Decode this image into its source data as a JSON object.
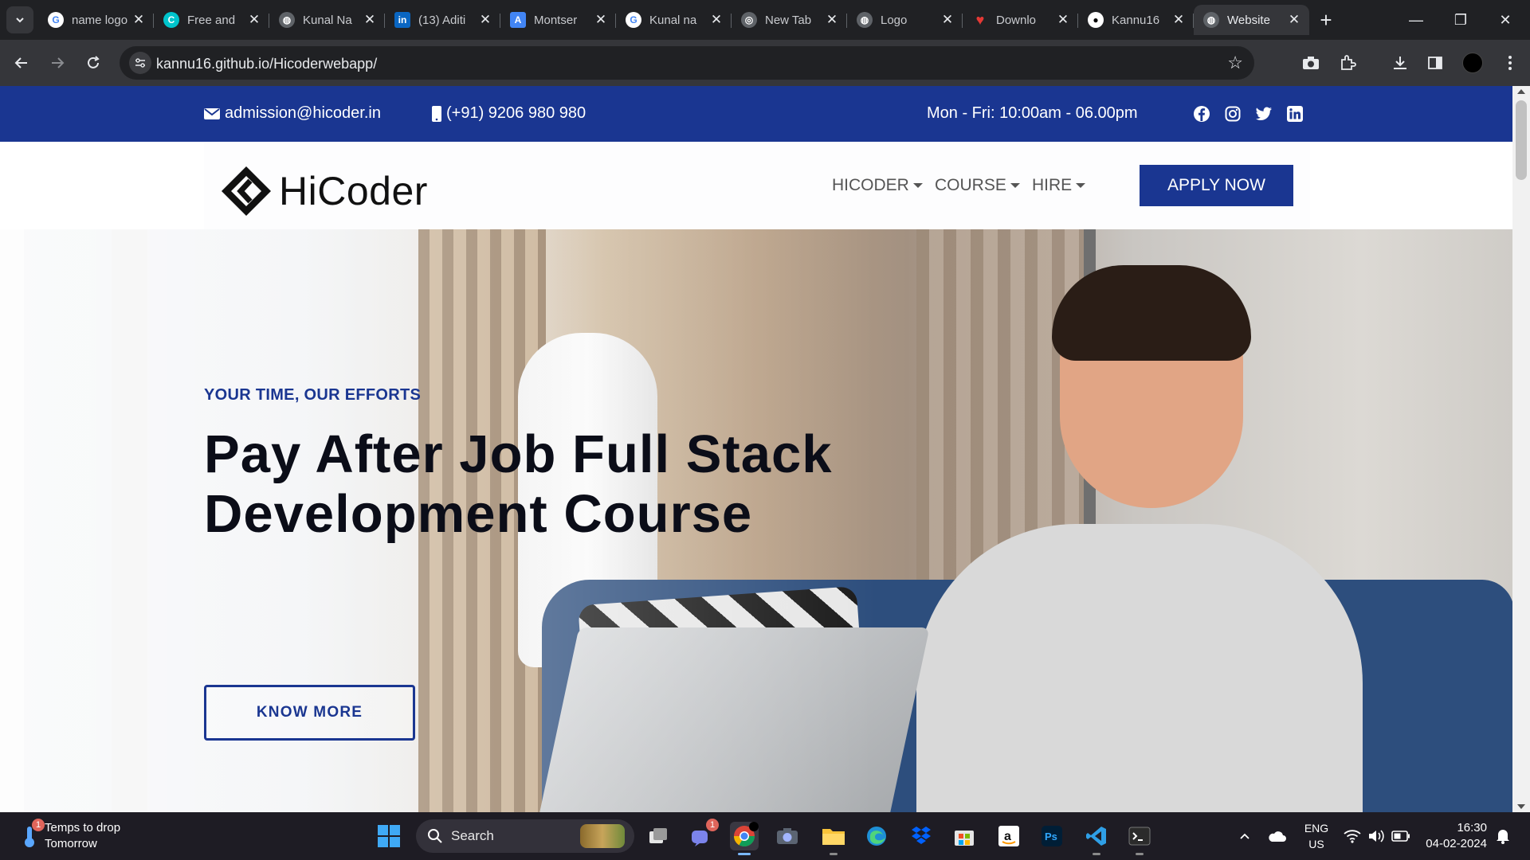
{
  "browser": {
    "tabs": [
      {
        "title": "name logo",
        "favicon": "google-icon",
        "color": "#ffffff"
      },
      {
        "title": "Free and",
        "favicon": "canva-icon",
        "color": "#00c4cc"
      },
      {
        "title": "Kunal Na",
        "favicon": "globe-icon",
        "color": "#9aa0a6"
      },
      {
        "title": "(13) Aditi",
        "favicon": "linkedin-icon",
        "color": "#0a66c2"
      },
      {
        "title": "Montser",
        "favicon": "google-fonts-icon",
        "color": "#4285f4"
      },
      {
        "title": "Kunal na",
        "favicon": "google-icon",
        "color": "#ffffff"
      },
      {
        "title": "New Tab",
        "favicon": "chrome-icon",
        "color": "#9aa0a6"
      },
      {
        "title": "Logo",
        "favicon": "globe-icon",
        "color": "#9aa0a6"
      },
      {
        "title": "Downlo",
        "favicon": "heart-icon",
        "color": "#e53935"
      },
      {
        "title": "Kannu16",
        "favicon": "github-icon",
        "color": "#ffffff"
      },
      {
        "title": "Website",
        "favicon": "globe-icon",
        "color": "#9aa0a6",
        "active": true
      }
    ],
    "url": "kannu16.github.io/Hicoderwebapp/"
  },
  "site": {
    "topbar": {
      "email": "admission@hicoder.in",
      "phone": "(+91) 9206 980 980",
      "hours": "Mon - Fri: 10:00am - 06.00pm"
    },
    "logo_text": "HiCoder",
    "menu": [
      {
        "label": "HICODER"
      },
      {
        "label": "COURSE"
      },
      {
        "label": "HIRE"
      }
    ],
    "apply_label": "APPLY NOW",
    "hero": {
      "tagline": "YOUR TIME, OUR EFFORTS",
      "headline_line1": "Pay After Job Full Stack",
      "headline_line2": "Development Course",
      "cta_label": "KNOW MORE"
    },
    "colors": {
      "primary": "#1a3691"
    }
  },
  "taskbar": {
    "weather_line1": "Temps to drop",
    "weather_line2": "Tomorrow",
    "weather_badge": "1",
    "search_label": "Search",
    "teams_badge": "1",
    "lang_line1": "ENG",
    "lang_line2": "US",
    "time": "16:30",
    "date": "04-02-2024"
  }
}
